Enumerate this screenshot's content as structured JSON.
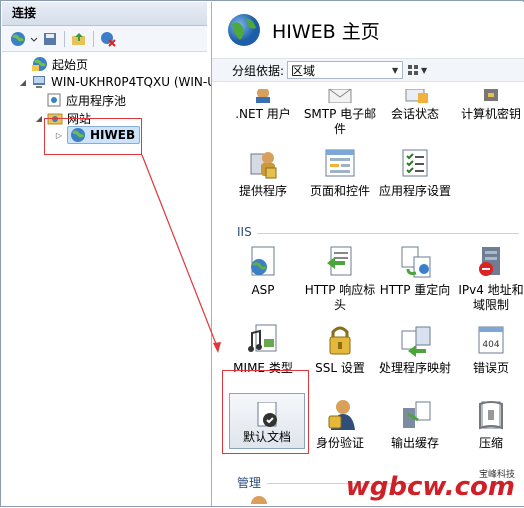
{
  "left_pane": {
    "title": "连接",
    "tree": [
      {
        "label": "起始页"
      },
      {
        "label": "WIN-UKHR0P4TQXU (WIN-UK"
      },
      {
        "label": "应用程序池"
      },
      {
        "label": "网站"
      },
      {
        "label": "HIWEB"
      }
    ]
  },
  "right_pane": {
    "title": "HIWEB 主页",
    "group_label": "分组依据:",
    "group_value": "区域",
    "top_items": [
      ".NET 用户",
      "SMTP 电子邮件",
      "会话状态",
      "计算机密钥",
      "提供程序",
      "页面和控件",
      "应用程序设置"
    ],
    "sections": {
      "iis": "IIS",
      "manage": "管理"
    },
    "iis_items": [
      "ASP",
      "HTTP 响应标头",
      "HTTP 重定向",
      "IPv4 地址和域限制",
      "MIME 类型",
      "SSL 设置",
      "处理程序映射",
      "错误页",
      "默认文档",
      "身份验证",
      "输出缓存",
      "压缩"
    ]
  },
  "watermark": {
    "text": "wgbcw.com",
    "small": "宝峰科技"
  },
  "colors": {
    "annotation": "#e0383a",
    "watermark": "#d02027"
  }
}
